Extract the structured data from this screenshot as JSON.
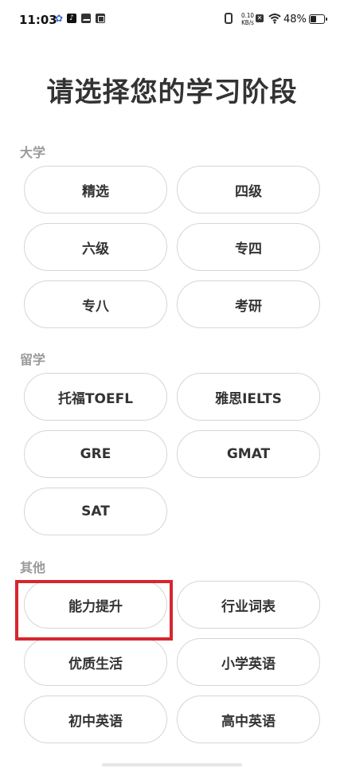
{
  "status_bar": {
    "time": "11:03",
    "network_speed_value": "0.10",
    "network_speed_unit": "KB/s",
    "battery_text": "48%",
    "battery_level": 0.48,
    "icons": [
      "paw-icon",
      "tiktok-icon",
      "mail-icon",
      "box-icon",
      "vibrate-icon",
      "no-sim-icon",
      "wifi-icon",
      "battery-icon"
    ]
  },
  "title": "请选择您的学习阶段",
  "sections": {
    "university": {
      "label": "大学",
      "options": [
        "精选",
        "四级",
        "六级",
        "专四",
        "专八",
        "考研"
      ]
    },
    "abroad": {
      "label": "留学",
      "options": [
        "托福TOEFL",
        "雅思IELTS",
        "GRE",
        "GMAT",
        "SAT"
      ]
    },
    "other": {
      "label": "其他",
      "options": [
        "能力提升",
        "行业词表",
        "优质生活",
        "小学英语",
        "初中英语",
        "高中英语"
      ]
    }
  },
  "highlight_color": "#d6262e"
}
